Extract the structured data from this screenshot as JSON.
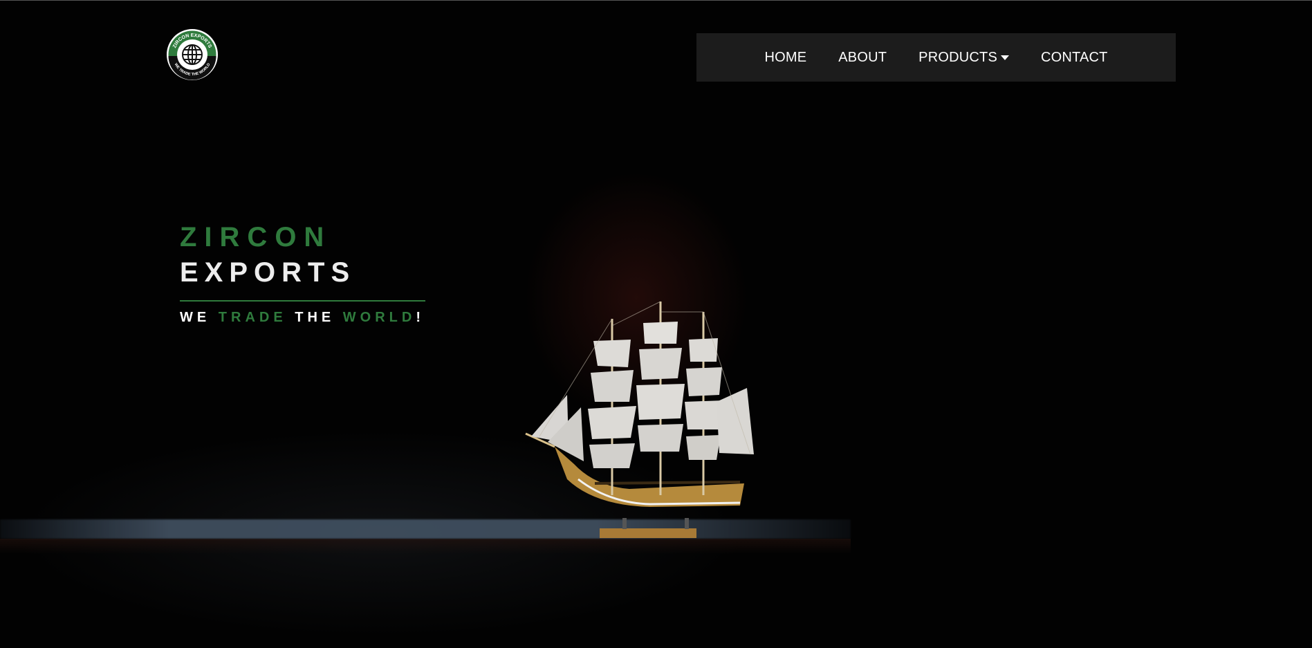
{
  "logo": {
    "ring_text_top": "ZIRCON EXPORTS",
    "ring_text_bottom": "WE TRADE THE WORLD",
    "icon": "globe-icon"
  },
  "nav": {
    "items": [
      {
        "label": "HOME"
      },
      {
        "label": "ABOUT"
      },
      {
        "label": "PRODUCTS",
        "icon": "caret-down-icon"
      },
      {
        "label": "CONTACT"
      }
    ]
  },
  "hero": {
    "title_line1": "ZIRCON",
    "title_line2": "EXPORTS",
    "tagline": {
      "w1": "WE",
      "w2": "TRADE",
      "w3": "THE",
      "w4": "WORLD",
      "punct": "!"
    },
    "image": "ship-model-icon"
  },
  "colors": {
    "accent_green": "#2f7b3d",
    "nav_bg": "#1c1c1c",
    "background": "#020202",
    "text_light": "#ededed"
  }
}
